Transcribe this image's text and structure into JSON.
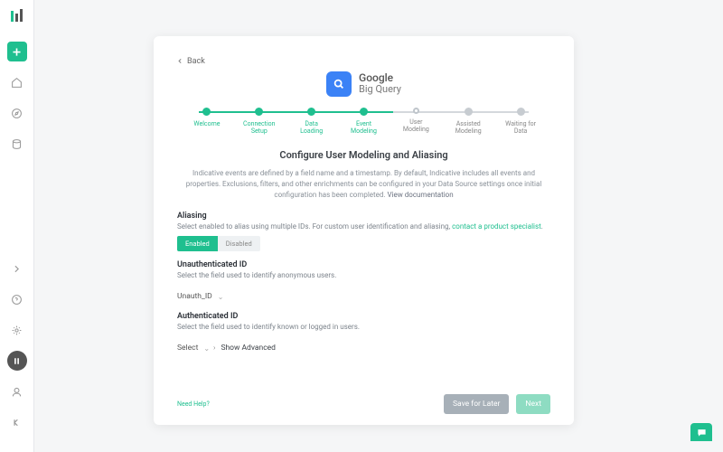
{
  "back_label": "Back",
  "brand": {
    "l1": "Google",
    "l2": "Big Query"
  },
  "steps": [
    {
      "label": "Welcome",
      "state": "done"
    },
    {
      "label": "Connection\nSetup",
      "state": "done"
    },
    {
      "label": "Data\nLoading",
      "state": "done"
    },
    {
      "label": "Event\nModeling",
      "state": "done"
    },
    {
      "label": "User\nModeling",
      "state": "current"
    },
    {
      "label": "Assisted\nModeling",
      "state": "todo"
    },
    {
      "label": "Waiting for\nData",
      "state": "todo"
    }
  ],
  "heading": "Configure User Modeling and Aliasing",
  "intro": "Indicative events are defined by a field name and a timestamp. By default, Indicative includes all events and properties. Exclusions, filters, and other enrichments can be configured in your Data Source settings once initial configuration has been completed. ",
  "intro_link": "View documentation",
  "aliasing": {
    "title": "Aliasing",
    "desc": "Select enabled to alias using multiple IDs. For custom user identification and aliasing, ",
    "desc_link": "contact a product specialist",
    "enabled": "Enabled",
    "disabled": "Disabled"
  },
  "unauth": {
    "title": "Unauthenticated ID",
    "desc": "Select the field used to identify anonymous users.",
    "value": "Unauth_ID"
  },
  "auth": {
    "title": "Authenticated ID",
    "desc": "Select the field used to identify known or logged in users.",
    "value": "Select"
  },
  "show_advanced": "Show Advanced",
  "help": "Need Help?",
  "buttons": {
    "save": "Save for Later",
    "next": "Next"
  }
}
